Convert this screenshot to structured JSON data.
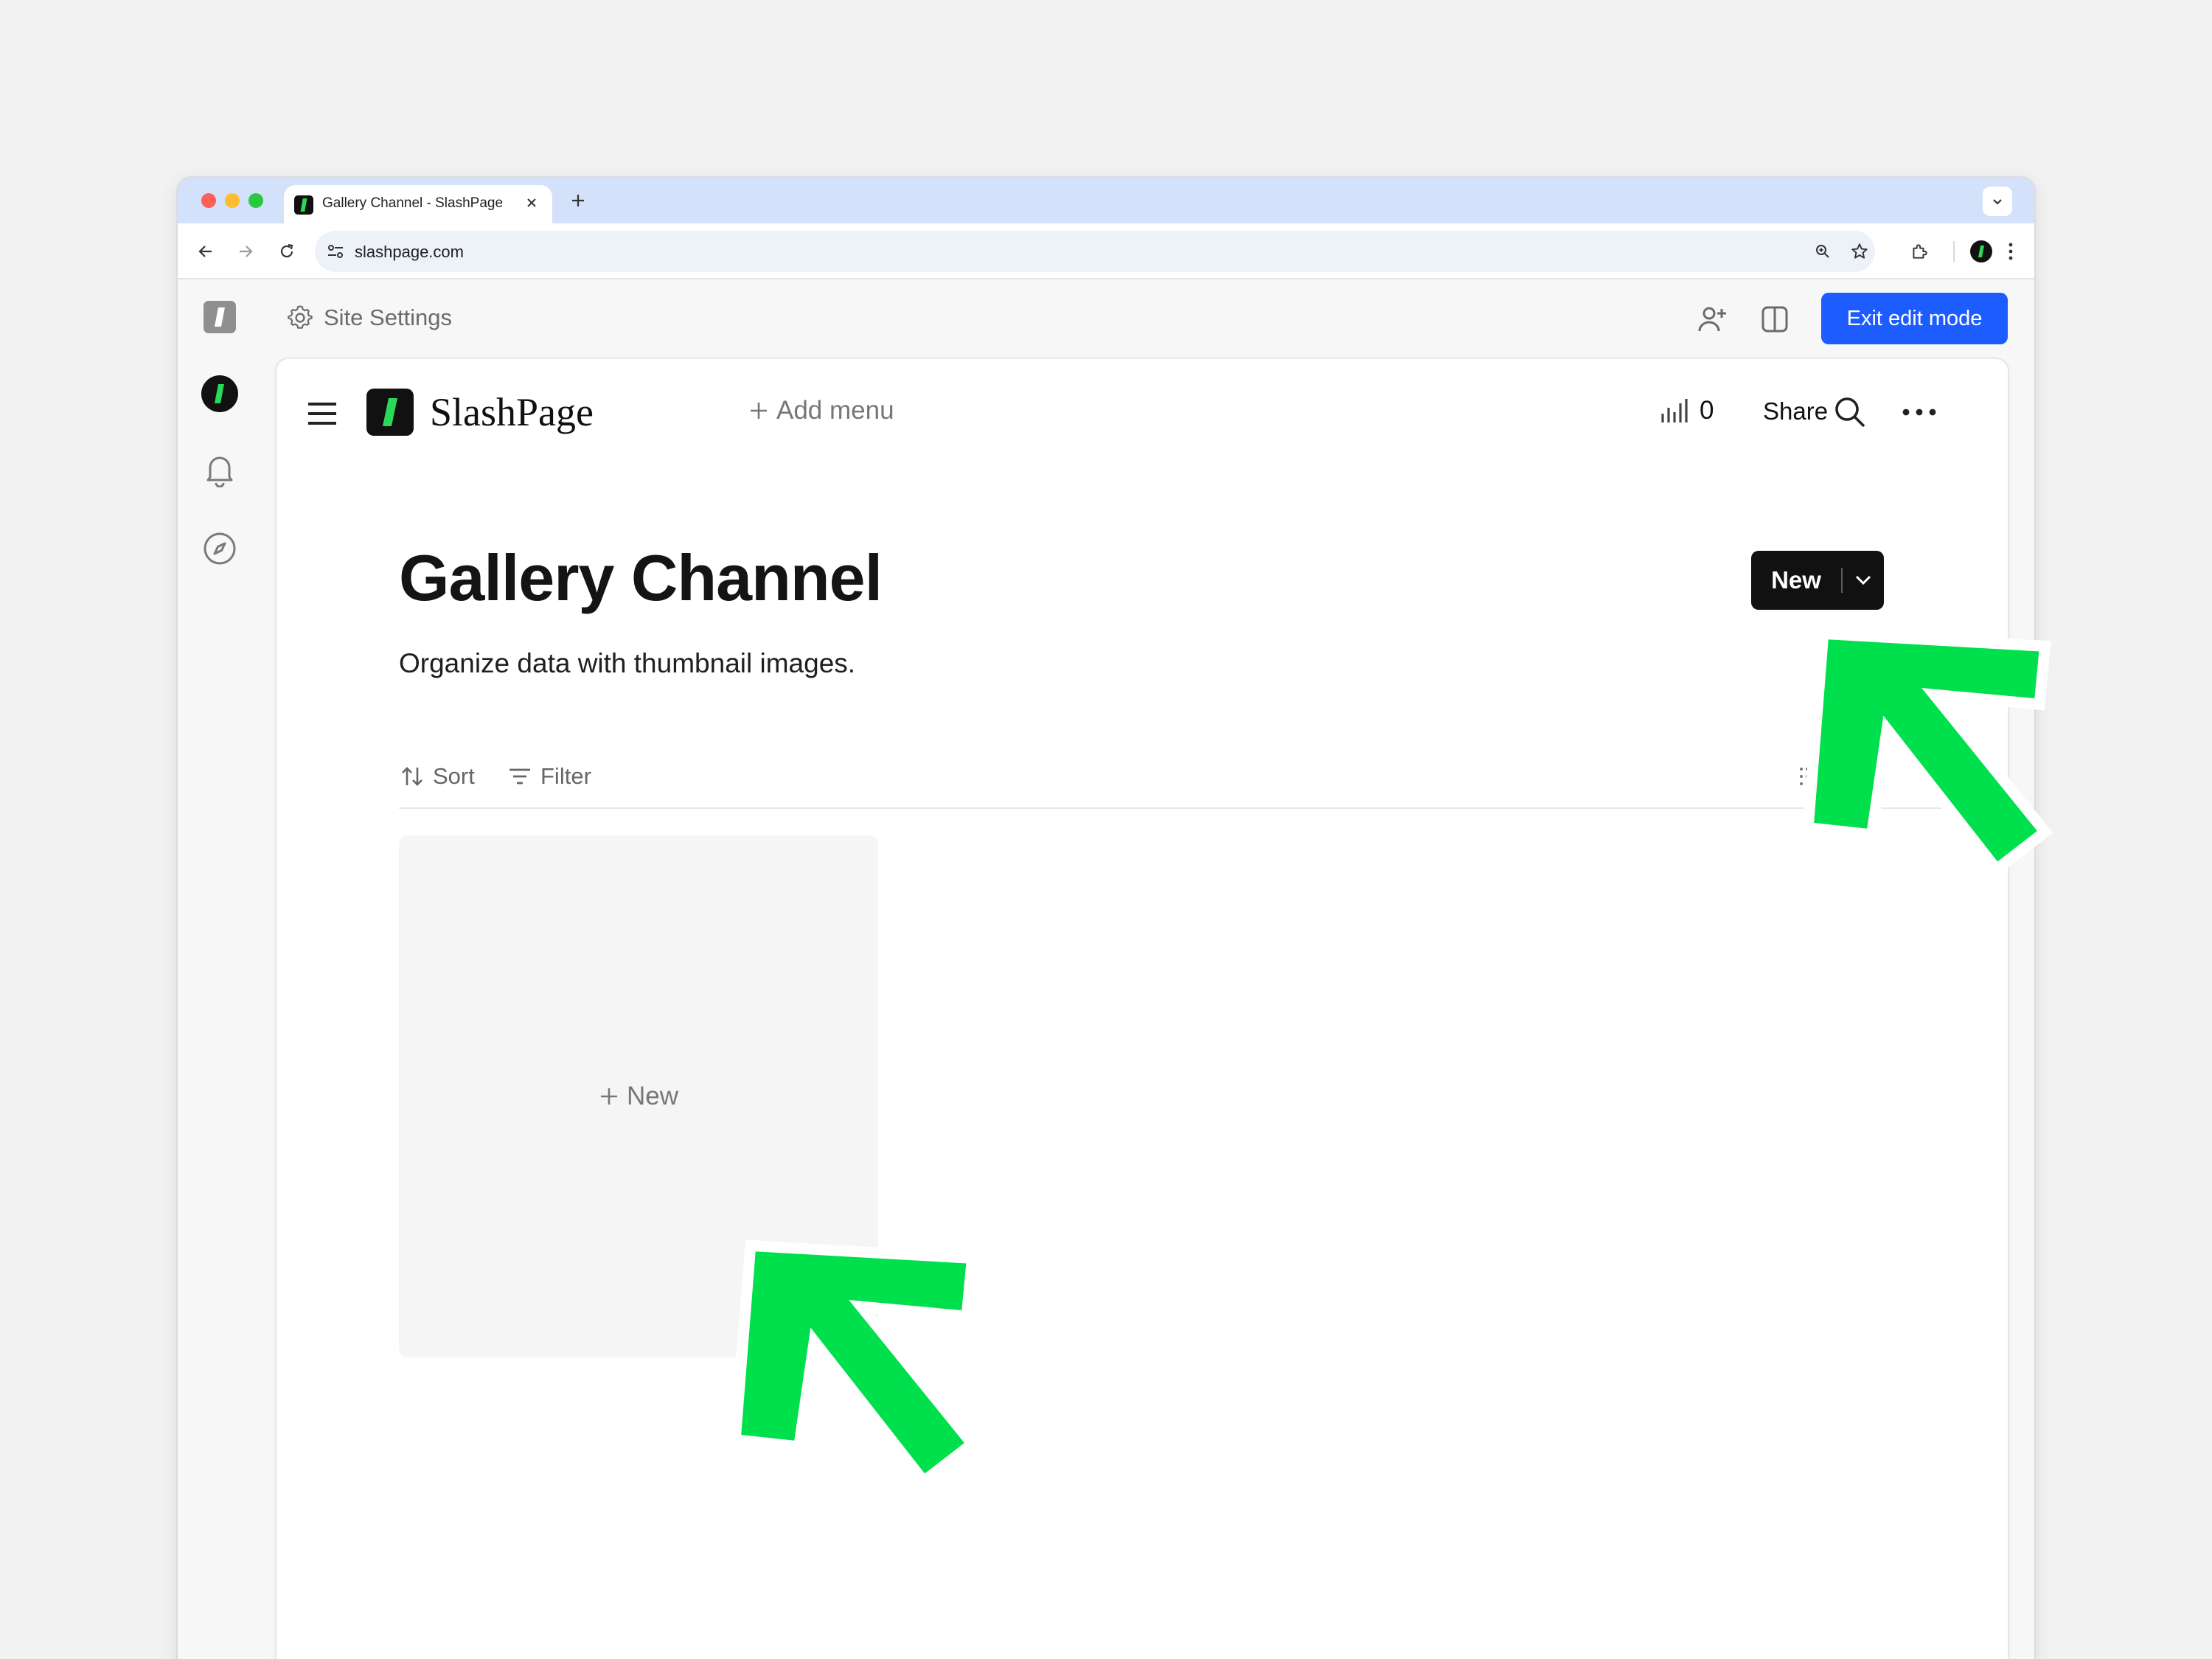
{
  "browser": {
    "tab_title": "Gallery Channel - SlashPage",
    "url": "slashpage.com"
  },
  "editor": {
    "site_settings_label": "Site Settings",
    "exit_edit_label": "Exit edit mode"
  },
  "site": {
    "brand_name": "SlashPage",
    "add_menu_label": "Add menu",
    "view_count": "0",
    "share_label": "Share"
  },
  "channel": {
    "title": "Gallery Channel",
    "description": "Organize data with thumbnail images.",
    "new_button_label": "New",
    "sort_label": "Sort",
    "filter_label": "Filter",
    "card_new_label": "New"
  },
  "colors": {
    "accent": "#1d5cff",
    "brand_green": "#2bd95a",
    "annotation_arrow": "#00e04c"
  },
  "icons": [
    "search-icon",
    "gear-icon",
    "bell-icon",
    "compass-icon",
    "bar-chart-icon",
    "ellipsis-icon",
    "chevron-down-icon",
    "plus-icon"
  ]
}
